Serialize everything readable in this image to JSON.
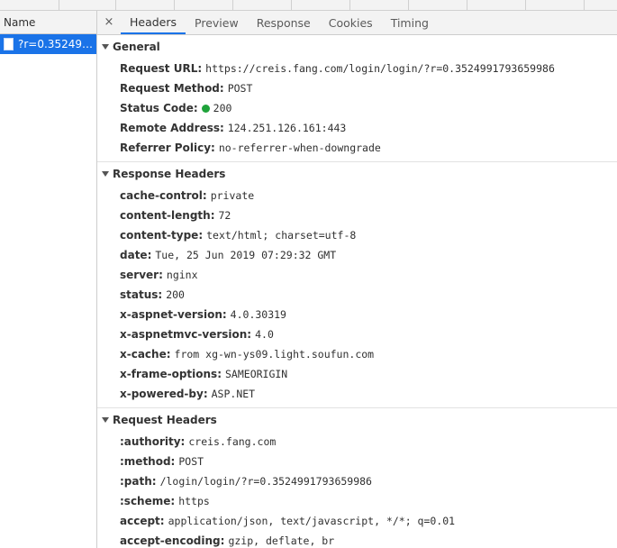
{
  "name_column": {
    "header": "Name",
    "selected_request": "?r=0.3524991..."
  },
  "tabs": [
    "Headers",
    "Preview",
    "Response",
    "Cookies",
    "Timing"
  ],
  "close_symbol": "×",
  "general": {
    "title": "General",
    "rows": [
      {
        "key": "Request URL:",
        "value": "https://creis.fang.com/login/login/?r=0.3524991793659986"
      },
      {
        "key": "Request Method:",
        "value": "POST"
      },
      {
        "key": "Status Code:",
        "value": "200"
      },
      {
        "key": "Remote Address:",
        "value": "124.251.126.161:443"
      },
      {
        "key": "Referrer Policy:",
        "value": "no-referrer-when-downgrade"
      }
    ]
  },
  "response_headers": {
    "title": "Response Headers",
    "rows": [
      {
        "key": "cache-control:",
        "value": "private"
      },
      {
        "key": "content-length:",
        "value": "72"
      },
      {
        "key": "content-type:",
        "value": "text/html; charset=utf-8"
      },
      {
        "key": "date:",
        "value": "Tue, 25 Jun 2019 07:29:32 GMT"
      },
      {
        "key": "server:",
        "value": "nginx"
      },
      {
        "key": "status:",
        "value": "200"
      },
      {
        "key": "x-aspnet-version:",
        "value": "4.0.30319"
      },
      {
        "key": "x-aspnetmvc-version:",
        "value": "4.0"
      },
      {
        "key": "x-cache:",
        "value": "from xg-wn-ys09.light.soufun.com"
      },
      {
        "key": "x-frame-options:",
        "value": "SAMEORIGIN"
      },
      {
        "key": "x-powered-by:",
        "value": "ASP.NET"
      }
    ]
  },
  "request_headers": {
    "title": "Request Headers",
    "rows": [
      {
        "key": ":authority:",
        "value": "creis.fang.com"
      },
      {
        "key": ":method:",
        "value": "POST"
      },
      {
        "key": ":path:",
        "value": "/login/login/?r=0.3524991793659986"
      },
      {
        "key": ":scheme:",
        "value": "https"
      },
      {
        "key": "accept:",
        "value": "application/json, text/javascript, */*; q=0.01"
      },
      {
        "key": "accept-encoding:",
        "value": "gzip, deflate, br"
      }
    ]
  },
  "colors": {
    "selection": "#1a73e8",
    "status_ok": "#1fa33a"
  }
}
